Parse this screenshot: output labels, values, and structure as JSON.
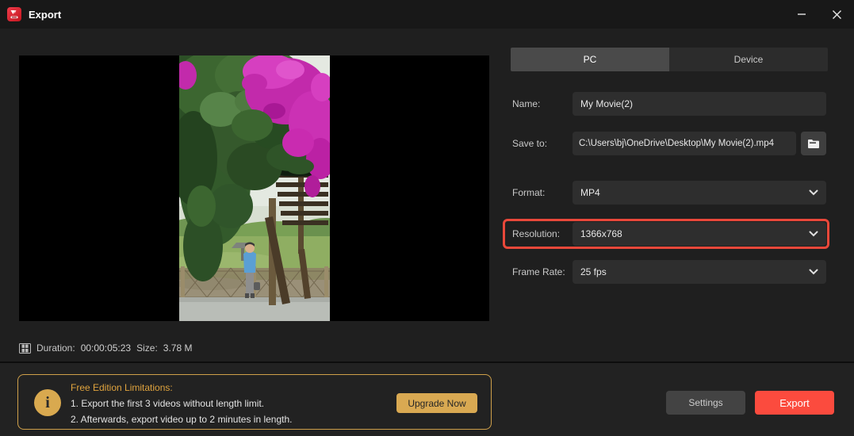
{
  "window": {
    "title": "Export"
  },
  "tabs": [
    {
      "label": "PC",
      "active": true
    },
    {
      "label": "Device",
      "active": false
    }
  ],
  "form": {
    "name": {
      "label": "Name:",
      "value": "My Movie(2)"
    },
    "save_to": {
      "label": "Save to:",
      "value": "C:\\Users\\bj\\OneDrive\\Desktop\\My Movie(2).mp4"
    },
    "format": {
      "label": "Format:",
      "value": "MP4"
    },
    "resolution": {
      "label": "Resolution:",
      "value": "1366x768",
      "highlighted": true
    },
    "frame_rate": {
      "label": "Frame Rate:",
      "value": "25 fps"
    }
  },
  "preview": {
    "description": "vertical video frame of magenta bougainvillea over wooden stairs and deck with a person at a fence",
    "duration_label": "Duration:",
    "duration_value": "00:00:05:23",
    "size_label": "Size:",
    "size_value": "3.78 M"
  },
  "free_edition": {
    "title": "Free Edition Limitations:",
    "lines": [
      "1. Export the first 3 videos without length limit.",
      "2. Afterwards, export video up to 2 minutes in length."
    ],
    "upgrade_label": "Upgrade Now"
  },
  "actions": {
    "settings_label": "Settings",
    "export_label": "Export"
  },
  "colors": {
    "accent_red": "#fb4b3e",
    "highlight_border": "#e9483a",
    "gold": "#d9a94f",
    "active_tab": "#4a4a4a",
    "field_bg": "#2e2e2e",
    "background": "#1f1f1f"
  }
}
